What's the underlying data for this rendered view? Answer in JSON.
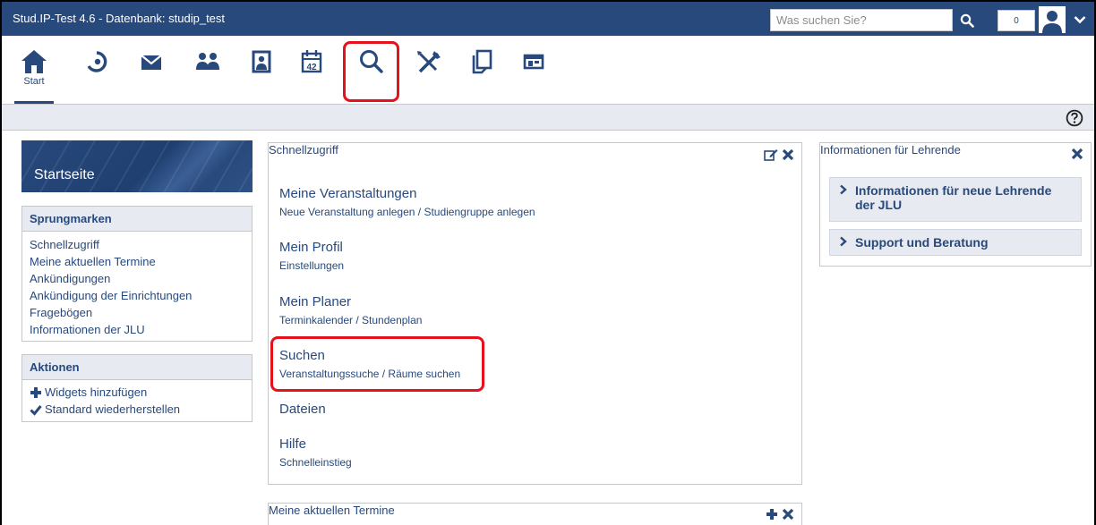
{
  "topbar": {
    "title": "Stud.IP-Test 4.6 - Datenbank: studip_test",
    "search_placeholder": "Was suchen Sie?",
    "notification_count": "0"
  },
  "nav": {
    "items": [
      {
        "icon": "home-icon",
        "label": "Start"
      },
      {
        "icon": "activity-icon",
        "label": ""
      },
      {
        "icon": "mail-icon",
        "label": ""
      },
      {
        "icon": "community-icon",
        "label": ""
      },
      {
        "icon": "profile-icon",
        "label": ""
      },
      {
        "icon": "calendar-icon",
        "label": ""
      },
      {
        "icon": "search-icon",
        "label": ""
      },
      {
        "icon": "tools-icon",
        "label": ""
      },
      {
        "icon": "files-icon",
        "label": ""
      },
      {
        "icon": "rooms-icon",
        "label": ""
      }
    ],
    "calendar_day": "42"
  },
  "sidebar": {
    "title": "Startseite",
    "jump_header": "Sprungmarken",
    "jump_links": [
      "Schnellzugriff",
      "Meine aktuellen Termine",
      "Ankündigungen",
      "Ankündigung der Einrichtungen",
      "Fragebögen",
      "Informationen der JLU"
    ],
    "actions_header": "Aktionen",
    "actions": [
      {
        "icon": "plus-icon",
        "label": "Widgets hinzufügen"
      },
      {
        "icon": "check-icon",
        "label": "Standard wiederherstellen"
      }
    ]
  },
  "quick": {
    "header": "Schnellzugriff",
    "entries": [
      {
        "title": "Meine Veranstaltungen",
        "sub": "Neue Veranstaltung anlegen / Studiengruppe anlegen"
      },
      {
        "title": "Mein Profil",
        "sub": "Einstellungen"
      },
      {
        "title": "Mein Planer",
        "sub": "Terminkalender / Stundenplan"
      },
      {
        "title": "Suchen",
        "sub": "Veranstaltungssuche / Räume suchen"
      },
      {
        "title": "Dateien",
        "sub": ""
      },
      {
        "title": "Hilfe",
        "sub": "Schnelleinstieg"
      }
    ]
  },
  "termine": {
    "header": "Meine aktuellen Termine"
  },
  "info": {
    "header": "Informationen für Lehrende",
    "items": [
      "Informationen für neue Lehrende der JLU",
      "Support und Beratung"
    ]
  },
  "colors": {
    "brand": "#28497c",
    "highlight": "#e5121b",
    "panel": "#e7ebf1"
  }
}
